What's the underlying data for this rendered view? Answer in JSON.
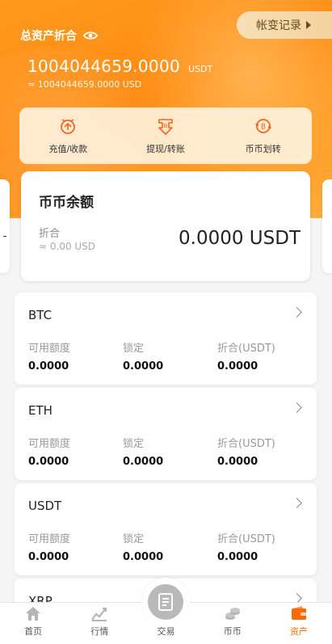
{
  "header": {
    "total_label": "总资产折合",
    "record_button": "帐变记录",
    "total_value": "1004044659.0000",
    "total_unit": "USDT",
    "total_usd": "≈ 1004044659.0000 USD"
  },
  "actions": [
    {
      "label": "充值/收款",
      "icon": "deposit-icon"
    },
    {
      "label": "提现/转账",
      "icon": "withdraw-icon"
    },
    {
      "label": "币币划转",
      "icon": "transfer-icon"
    }
  ],
  "balance_card": {
    "title": "币币余额",
    "sub_label": "折合",
    "sub_usd": "≈ 0.00 USD",
    "amount": "0.0000 USDT"
  },
  "coins": [
    {
      "name": "BTC",
      "available_label": "可用额度",
      "available": "0.0000",
      "locked_label": "锁定",
      "locked": "0.0000",
      "converted_label": "折合(USDT)",
      "converted": "0.0000"
    },
    {
      "name": "ETH",
      "available_label": "可用额度",
      "available": "0.0000",
      "locked_label": "锁定",
      "locked": "0.0000",
      "converted_label": "折合(USDT)",
      "converted": "0.0000"
    },
    {
      "name": "USDT",
      "available_label": "可用额度",
      "available": "0.0000",
      "locked_label": "锁定",
      "locked": "0.0000",
      "converted_label": "折合(USDT)",
      "converted": "0.0000"
    },
    {
      "name": "XRP"
    }
  ],
  "tabbar": [
    {
      "label": "首页",
      "icon": "home-icon"
    },
    {
      "label": "行情",
      "icon": "chart-icon"
    },
    {
      "label": "交易",
      "icon": "trade-icon"
    },
    {
      "label": "币币",
      "icon": "coins-icon"
    },
    {
      "label": "资产",
      "icon": "wallet-icon",
      "active": true
    }
  ],
  "colors": {
    "accent": "#ff8a10",
    "active_tab": "#ff6a00",
    "record_bg": "#f3d39d"
  }
}
